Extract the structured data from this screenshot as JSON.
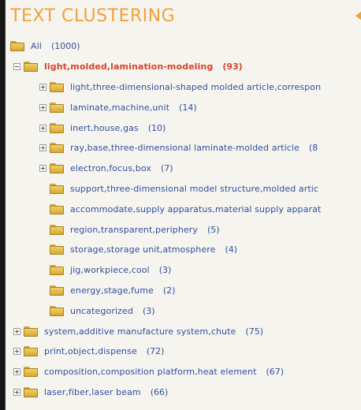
{
  "header": {
    "title": "TEXT CLUSTERING"
  },
  "tree": {
    "root": {
      "label": "All",
      "count": "(1000)"
    },
    "selected": {
      "label": "light,molded,lamination-modeling",
      "count": "(93)"
    },
    "children": [
      {
        "label": "light,three-dimensional-shaped molded article,correspon",
        "count": "",
        "expandable": true
      },
      {
        "label": "laminate,machine,unit",
        "count": "(14)",
        "expandable": true
      },
      {
        "label": "inert,house,gas",
        "count": "(10)",
        "expandable": true
      },
      {
        "label": "ray,base,three-dimensional laminate-molded article",
        "count": "(8",
        "expandable": true
      },
      {
        "label": "electron,focus,box",
        "count": "(7)",
        "expandable": true
      },
      {
        "label": "support,three-dimensional model structure,molded artic",
        "count": "",
        "expandable": false
      },
      {
        "label": "accommodate,supply apparatus,material supply apparat",
        "count": "",
        "expandable": false
      },
      {
        "label": "region,transparent,periphery",
        "count": "(5)",
        "expandable": false
      },
      {
        "label": "storage,storage unit,atmosphere",
        "count": "(4)",
        "expandable": false
      },
      {
        "label": "jig,workpiece,cool",
        "count": "(3)",
        "expandable": false
      },
      {
        "label": "energy,stage,fume",
        "count": "(2)",
        "expandable": false
      },
      {
        "label": "uncategorized",
        "count": "(3)",
        "expandable": false
      }
    ],
    "siblings": [
      {
        "label": "system,additive manufacture system,chute",
        "count": "(75)"
      },
      {
        "label": "print,object,dispense",
        "count": "(72)"
      },
      {
        "label": "composition,composition platform,heat element",
        "count": "(67)"
      },
      {
        "label": "laser,fiber,laser beam",
        "count": "(66)"
      }
    ]
  },
  "icons": {
    "folder": "folder-icon",
    "expand": "expand-plus-icon",
    "collapse": "collapse-minus-icon",
    "header_arrow": "collapse-arrow-icon"
  },
  "colors": {
    "title": "#f0a23a",
    "link": "#2f4fa0",
    "selected": "#d4452d",
    "panel": "#f6f4ef",
    "frame": "#151515"
  }
}
